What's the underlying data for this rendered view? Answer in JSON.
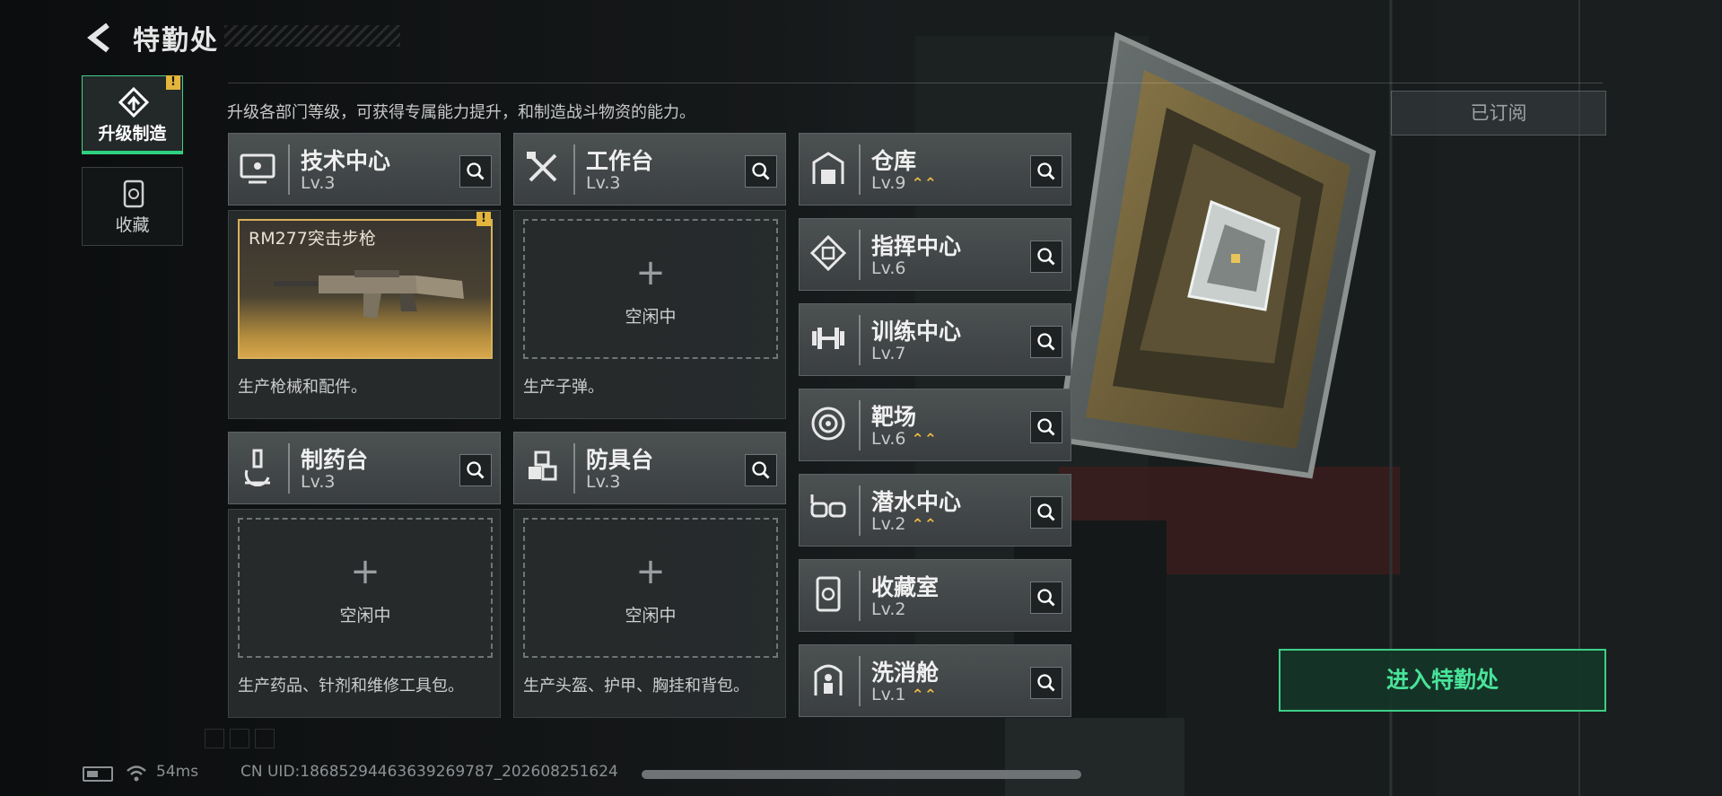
{
  "header": {
    "title": "特勤处",
    "description": "升级各部门等级，可获得专属能力提升，和制造战斗物资的能力。"
  },
  "nav": [
    {
      "label": "升级制造",
      "icon": "upgrade-arrow-icon",
      "alert": "!"
    },
    {
      "label": "收藏",
      "icon": "collection-icon"
    }
  ],
  "departments": [
    {
      "name": "技术中心",
      "level": "Lv.3",
      "icon": "computer-icon"
    },
    {
      "name": "工作台",
      "level": "Lv.3",
      "icon": "tools-icon"
    },
    {
      "name": "仓库",
      "level": "Lv.9",
      "icon": "warehouse-icon",
      "upgradable": true
    },
    {
      "name": "指挥中心",
      "level": "Lv.6",
      "icon": "command-icon"
    },
    {
      "name": "训练中心",
      "level": "Lv.7",
      "icon": "dumbbell-icon"
    },
    {
      "name": "靶场",
      "level": "Lv.6",
      "icon": "target-icon",
      "upgradable": true
    },
    {
      "name": "潜水中心",
      "level": "Lv.2",
      "icon": "diving-mask-icon",
      "upgradable": true
    },
    {
      "name": "收藏室",
      "level": "Lv.2",
      "icon": "collection-room-icon"
    },
    {
      "name": "洗消舱",
      "level": "Lv.1",
      "icon": "decontamination-icon",
      "upgradable": true
    },
    {
      "name": "制药台",
      "level": "Lv.3",
      "icon": "microscope-icon"
    },
    {
      "name": "防具台",
      "level": "Lv.3",
      "icon": "armor-cubes-icon"
    }
  ],
  "production": [
    {
      "dept": "技术中心",
      "item": "RM277突击步枪",
      "alert": "!",
      "description": "生产枪械和配件。"
    },
    {
      "dept": "工作台",
      "status": "空闲中",
      "description": "生产子弹。"
    },
    {
      "dept": "制药台",
      "status": "空闲中",
      "description": "生产药品、针剂和维修工具包。"
    },
    {
      "dept": "防具台",
      "status": "空闲中",
      "description": "生产头盔、护甲、胸挂和背包。"
    }
  ],
  "subscribe_label": "已订阅",
  "enter_label": "进入特勤处",
  "status": {
    "ping": "54ms",
    "uid": "CN UID:18685294463639269787_202608251624"
  },
  "colors": {
    "accent_green": "#3ecf86",
    "upgrade_gold": "#e6b945",
    "alert_yellow": "#e3b53a"
  }
}
